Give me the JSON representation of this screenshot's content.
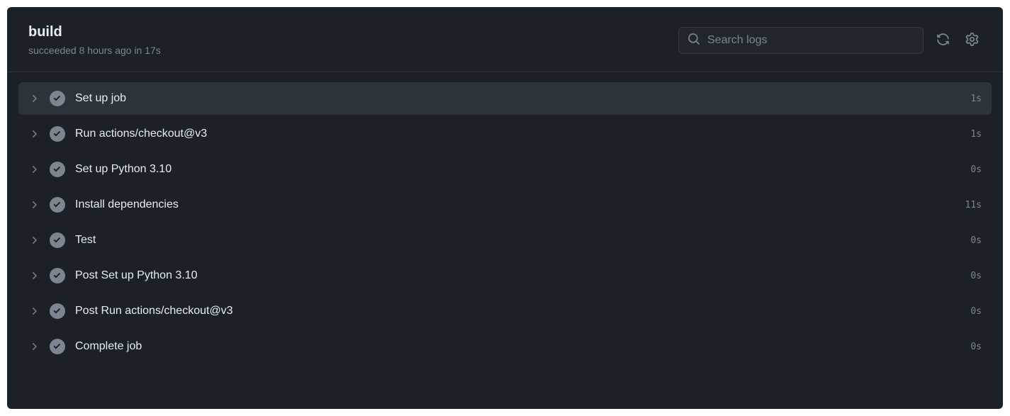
{
  "header": {
    "title": "build",
    "status_text": "succeeded 8 hours ago in 17s",
    "search_placeholder": "Search logs"
  },
  "steps": [
    {
      "name": "Set up job",
      "duration": "1s",
      "highlighted": true
    },
    {
      "name": "Run actions/checkout@v3",
      "duration": "1s",
      "highlighted": false
    },
    {
      "name": "Set up Python 3.10",
      "duration": "0s",
      "highlighted": false
    },
    {
      "name": "Install dependencies",
      "duration": "11s",
      "highlighted": false
    },
    {
      "name": "Test",
      "duration": "0s",
      "highlighted": false
    },
    {
      "name": "Post Set up Python 3.10",
      "duration": "0s",
      "highlighted": false
    },
    {
      "name": "Post Run actions/checkout@v3",
      "duration": "0s",
      "highlighted": false
    },
    {
      "name": "Complete job",
      "duration": "0s",
      "highlighted": false
    }
  ]
}
